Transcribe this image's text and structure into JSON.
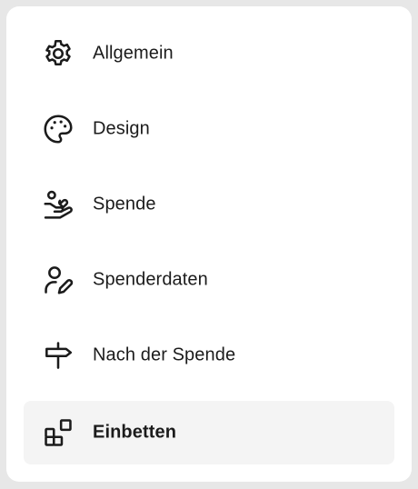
{
  "menu": {
    "items": [
      {
        "label": "Allgemein",
        "icon": "gear-icon",
        "active": false
      },
      {
        "label": "Design",
        "icon": "palette-icon",
        "active": false
      },
      {
        "label": "Spende",
        "icon": "hand-donation-icon",
        "active": false
      },
      {
        "label": "Spenderdaten",
        "icon": "user-edit-icon",
        "active": false
      },
      {
        "label": "Nach der Spende",
        "icon": "signpost-icon",
        "active": false
      },
      {
        "label": "Einbetten",
        "icon": "embed-blocks-icon",
        "active": true
      }
    ]
  },
  "colors": {
    "page_background": "#e7e7e7",
    "panel_background": "#ffffff",
    "active_item_background": "#f4f4f4",
    "text": "#1b1b1b",
    "icon": "#1b1b1b"
  }
}
